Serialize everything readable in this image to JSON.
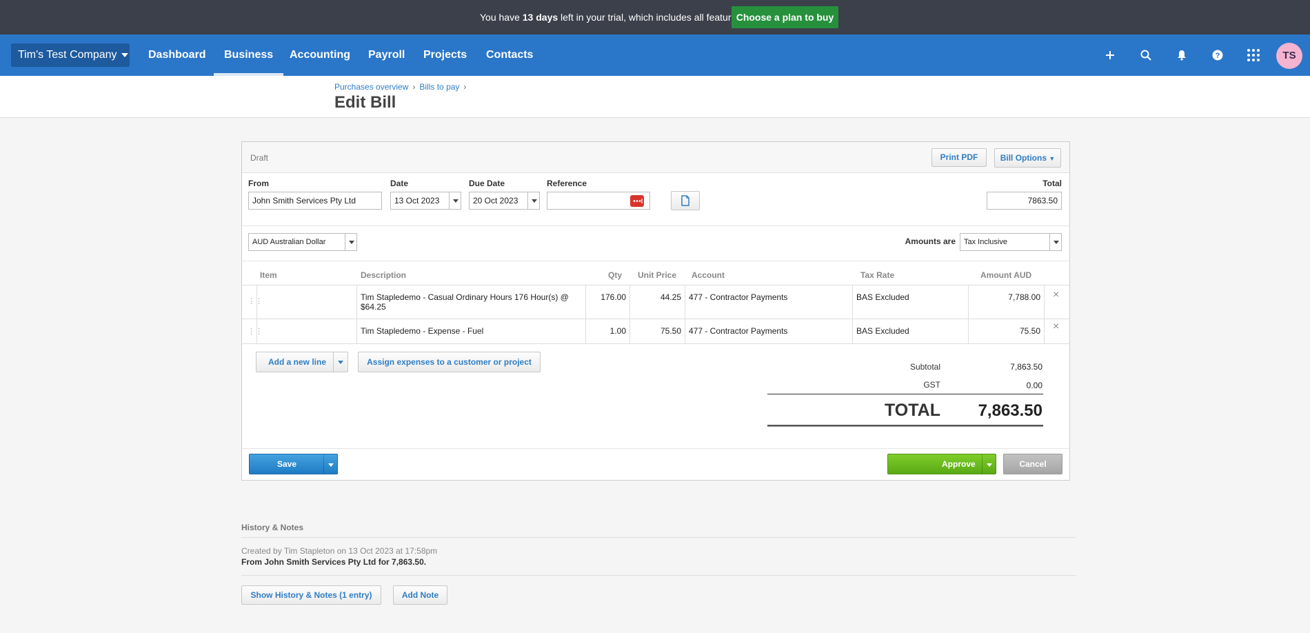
{
  "trial": {
    "text_before": "You have ",
    "days": "13 days",
    "text_after": " left in your trial, which includes all features",
    "cta": "Choose a plan to buy"
  },
  "nav": {
    "org": "Tim's Test Company",
    "items": [
      "Dashboard",
      "Business",
      "Accounting",
      "Payroll",
      "Projects",
      "Contacts"
    ],
    "active": "Business",
    "avatar": "TS"
  },
  "breadcrumb": [
    "Purchases overview",
    "Bills to pay"
  ],
  "page_title": "Edit Bill",
  "bill": {
    "status": "Draft",
    "print_pdf": "Print PDF",
    "bill_options": "Bill Options",
    "from_label": "From",
    "from_value": "John Smith Services Pty Ltd",
    "date_label": "Date",
    "date_value": "13 Oct 2023",
    "due_label": "Due Date",
    "due_value": "20 Oct 2023",
    "reference_label": "Reference",
    "reference_value": "",
    "total_label": "Total",
    "total_value": "7863.50",
    "currency": "AUD Australian Dollar",
    "amounts_are_label": "Amounts are",
    "amounts_are_value": "Tax Inclusive"
  },
  "table": {
    "headers": {
      "item": "Item",
      "description": "Description",
      "qty": "Qty",
      "unit_price": "Unit Price",
      "account": "Account",
      "tax_rate": "Tax Rate",
      "amount": "Amount AUD"
    },
    "rows": [
      {
        "item": "",
        "description": "Tim Stapledemo - Casual Ordinary Hours 176 Hour(s) @ $64.25",
        "qty": "176.00",
        "unit_price": "44.25",
        "account": "477 - Contractor Payments",
        "tax_rate": "BAS Excluded",
        "amount": "7,788.00"
      },
      {
        "item": "",
        "description": "Tim Stapledemo - Expense - Fuel",
        "qty": "1.00",
        "unit_price": "75.50",
        "account": "477 - Contractor Payments",
        "tax_rate": "BAS Excluded",
        "amount": "75.50"
      }
    ]
  },
  "actions": {
    "add_line": "Add a new line",
    "assign": "Assign expenses to a customer or project",
    "save": "Save",
    "approve": "Approve",
    "cancel": "Cancel"
  },
  "totals": {
    "subtotal_label": "Subtotal",
    "subtotal": "7,863.50",
    "gst_label": "GST",
    "gst": "0.00",
    "total_label": "TOTAL",
    "total": "7,863.50"
  },
  "history": {
    "title": "History & Notes",
    "meta": "Created by Tim Stapleton on 13 Oct 2023 at 17:58pm",
    "desc": "From John Smith Services Pty Ltd for 7,863.50.",
    "show_btn": "Show History & Notes (1 entry)",
    "add_note": "Add Note"
  }
}
